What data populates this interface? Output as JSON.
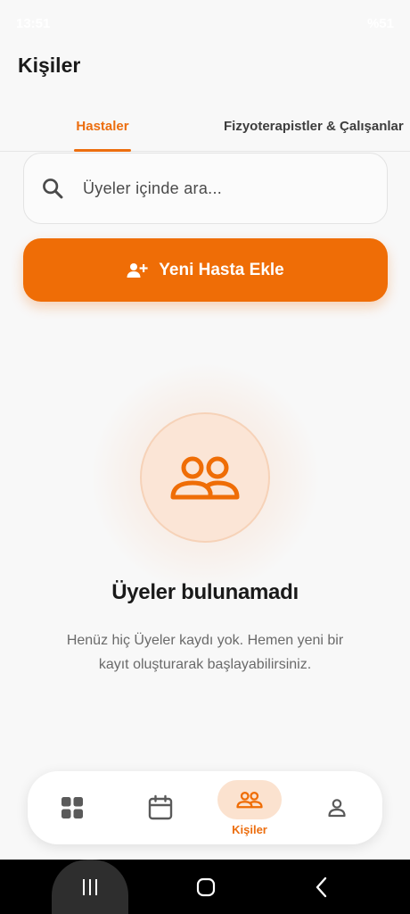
{
  "status_bar": {
    "time": "13:51",
    "right": "%51"
  },
  "page": {
    "title": "Kişiler"
  },
  "tabs": [
    {
      "label": "Hastaler",
      "active": true
    },
    {
      "label": "Fizyoterapistler & Çalışanlar",
      "active": false
    }
  ],
  "search": {
    "placeholder": "Üyeler içinde ara...",
    "icon": "search-icon"
  },
  "add_button": {
    "label": "Yeni Hasta Ekle",
    "icon": "person-add-icon"
  },
  "empty_state": {
    "icon": "people-icon",
    "title": "Üyeler bulunamadı",
    "description": "Henüz hiç Üyeler kaydı yok. Hemen yeni bir kayıt oluşturarak başlayabilirsiniz."
  },
  "bottom_nav": {
    "items": [
      {
        "icon": "dashboard-icon",
        "label": "",
        "active": false
      },
      {
        "icon": "calendar-icon",
        "label": "",
        "active": false
      },
      {
        "icon": "people-icon",
        "label": "Kişiler",
        "active": true
      },
      {
        "icon": "profile-icon",
        "label": "",
        "active": false
      }
    ]
  },
  "colors": {
    "accent": "#ef6d06",
    "accent_soft": "#fbe2cf",
    "background": "#f8f8f8"
  }
}
